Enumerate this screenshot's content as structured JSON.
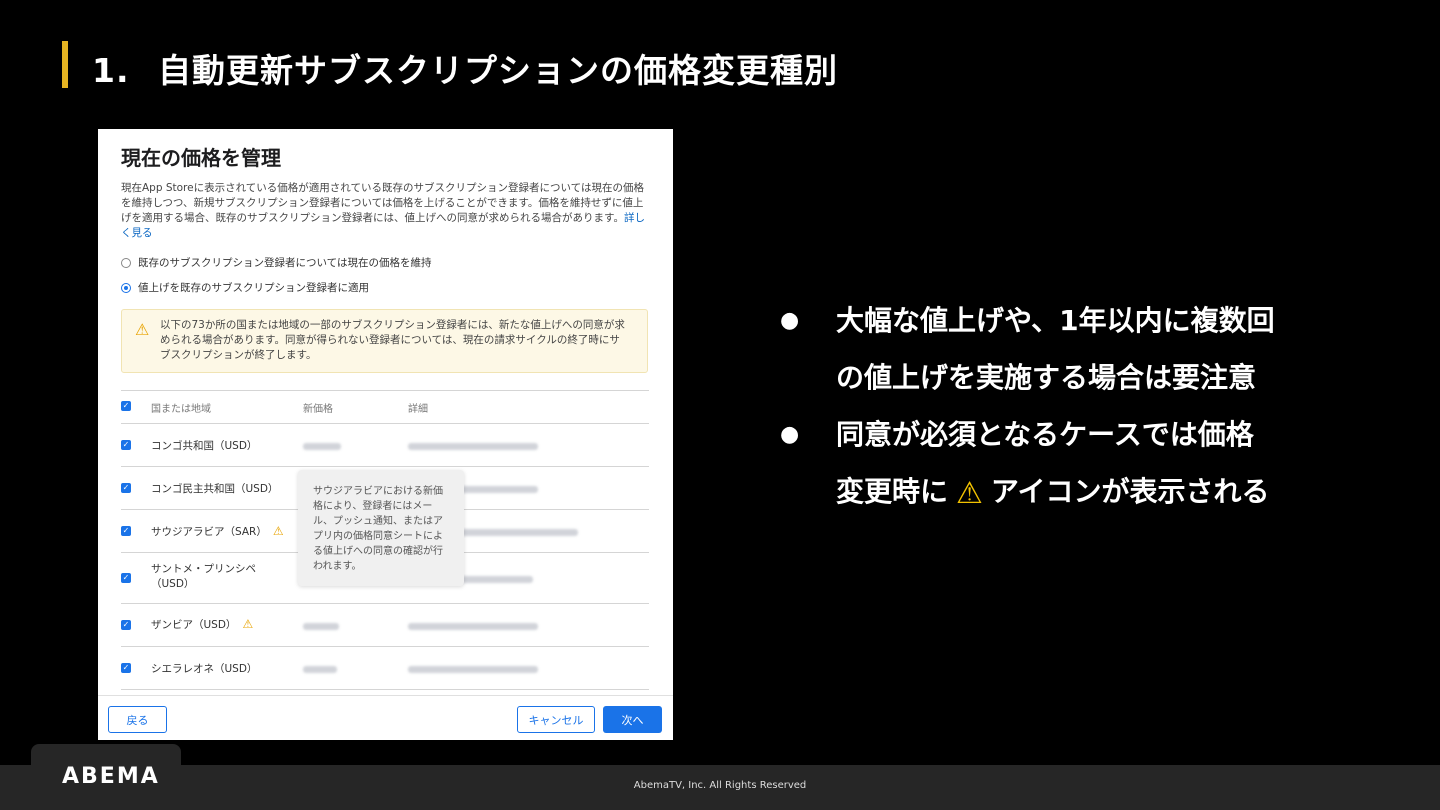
{
  "slide": {
    "number": "1.",
    "title": "自動更新サブスクリプションの価格変更種別"
  },
  "panel": {
    "title": "現在の価格を管理",
    "description": "現在App Storeに表示されている価格が適用されている既存のサブスクリプション登録者については現在の価格を維持しつつ、新規サブスクリプション登録者については価格を上げることができます。価格を維持せずに値上げを適用する場合、既存のサブスクリプション登録者には、値上げへの同意が求められる場合があります。",
    "learn_more": "詳しく見る",
    "radio_keep": "既存のサブスクリプション登録者については現在の価格を維持",
    "radio_apply": "値上げを既存のサブスクリプション登録者に適用",
    "selected_option": "radio_apply",
    "warning": "以下の73か所の国または地域の一部のサブスクリプション登録者には、新たな値上げへの同意が求められる場合があります。同意が得られない登録者については、現在の請求サイクルの終了時にサブスクリプションが終了します。",
    "table": {
      "headers": [
        "国または地域",
        "新価格",
        "詳細"
      ],
      "rows": [
        {
          "country": "コンゴ共和国（USD）",
          "warn": false
        },
        {
          "country": "コンゴ民主共和国（USD）",
          "warn": false
        },
        {
          "country": "サウジアラビア（SAR）",
          "warn": true
        },
        {
          "country": "サントメ・プリンシペ\n（USD）",
          "warn": false
        },
        {
          "country": "ザンビア（USD）",
          "warn": true
        },
        {
          "country": "シエラレオネ（USD）",
          "warn": false
        }
      ]
    },
    "tooltip": "サウジアラビアにおける新価格により、登録者にはメール、プッシュ通知、またはアプリ内の価格同意シートによる値上げへの同意の確認が行われます。",
    "buttons": {
      "back": "戻る",
      "cancel": "キャンセル",
      "next": "次へ"
    }
  },
  "bullets": {
    "b1_line1": "大幅な値上げや、1年以内に複数回",
    "b1_line2": "の値上げを実施する場合は要注意",
    "b2_line1": "同意が必須となるケースでは価格",
    "b2_line2_pre": "変更時に",
    "b2_line2_post": "アイコンが表示される",
    "bullet_glyph": "●",
    "warning_glyph": "⚠"
  },
  "footer": {
    "logo": "ABEMA",
    "copyright": "AbemaTV, Inc. All Rights Reserved"
  },
  "colors": {
    "accent_bar": "#e6b422",
    "primary_blue": "#1a73e8",
    "warning_yellow": "#f2c200"
  }
}
